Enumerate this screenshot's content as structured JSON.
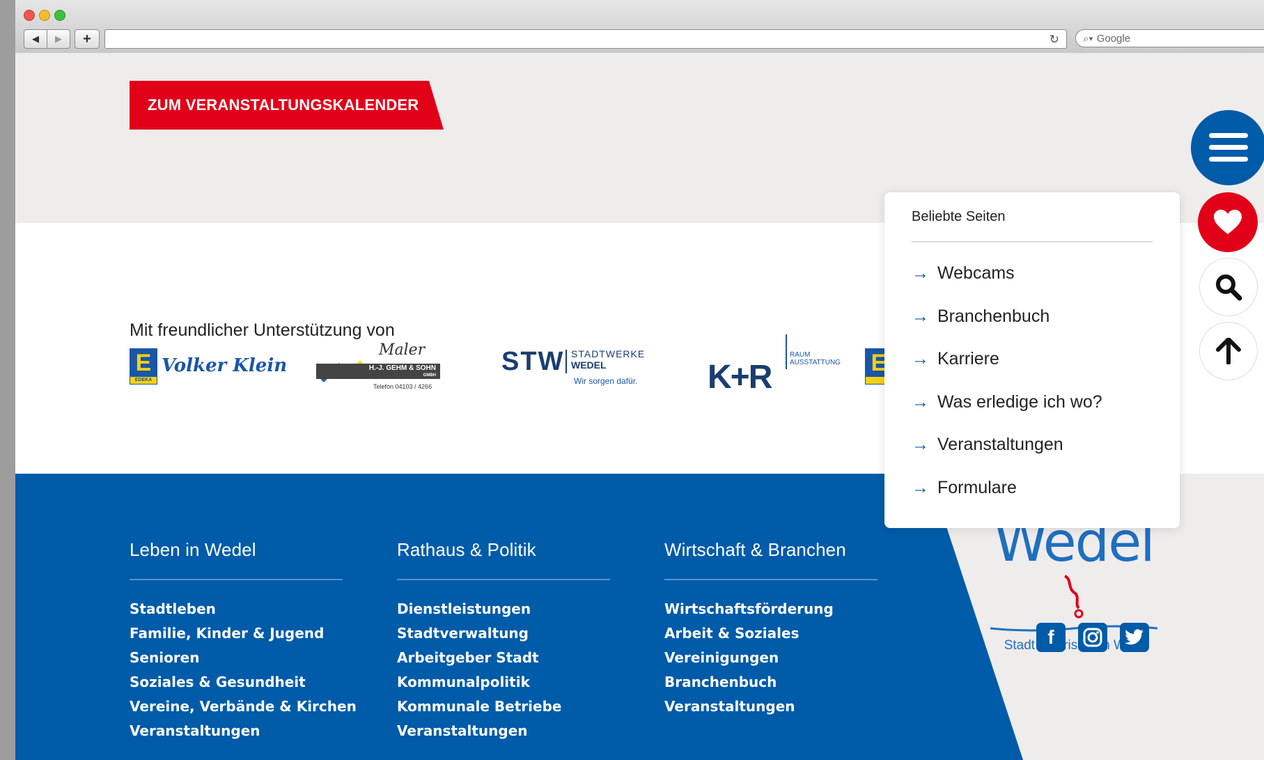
{
  "browser": {
    "search_placeholder": "Google",
    "plus_label": "+",
    "back_label": "◀",
    "forward_label": "▶",
    "reload_icon": "reload-icon"
  },
  "cta": {
    "label": "ZUM VERANSTALTUNGSKALENDER"
  },
  "sponsors": {
    "title": "Mit freundlicher Unterstützung von",
    "logos": [
      {
        "name": "Volker Klein",
        "badge": "E",
        "badge_sub": "EDEKA"
      },
      {
        "name": "Maler",
        "sub": "H.-J. GEHM & SOHN",
        "sub2": "GMBH",
        "phone": "Telefon 04103 / 4266"
      },
      {
        "name": "STW",
        "line1": "STADTWERKE",
        "line2": "WEDEL",
        "slogan": "Wir sorgen dafür."
      },
      {
        "name": "K+R",
        "line1": "RAUM",
        "line2": "AUSSTATTUNG"
      }
    ]
  },
  "footer": {
    "columns": [
      {
        "title": "Leben in Wedel",
        "links": [
          "Stadtleben",
          "Familie, Kinder & Jugend",
          "Senioren",
          "Soziales & Gesundheit",
          "Vereine, Verbände & Kirchen",
          "Veranstaltungen"
        ]
      },
      {
        "title": "Rathaus & Politik",
        "links": [
          "Dienstleistungen",
          "Stadtverwaltung",
          "Arbeitgeber Stadt",
          "Kommunalpolitik",
          "Kommunale Betriebe",
          "Veranstaltungen"
        ]
      },
      {
        "title": "Wirtschaft & Branchen",
        "links": [
          "Wirtschaftsförderung",
          "Arbeit & Soziales",
          "Vereinigungen",
          "Branchenbuch",
          "Veranstaltungen"
        ]
      }
    ],
    "brand": {
      "word": "Wedel",
      "tagline": "Stadt mit frischem Wind"
    }
  },
  "popup": {
    "title": "Beliebte Seiten",
    "items": [
      "Webcams",
      "Branchenbuch",
      "Karriere",
      "Was erledige ich wo?",
      "Veranstaltungen",
      "Formulare"
    ]
  },
  "colors": {
    "brand_blue": "#005ba9",
    "accent_red": "#e20019",
    "page_bg": "#efecec"
  }
}
